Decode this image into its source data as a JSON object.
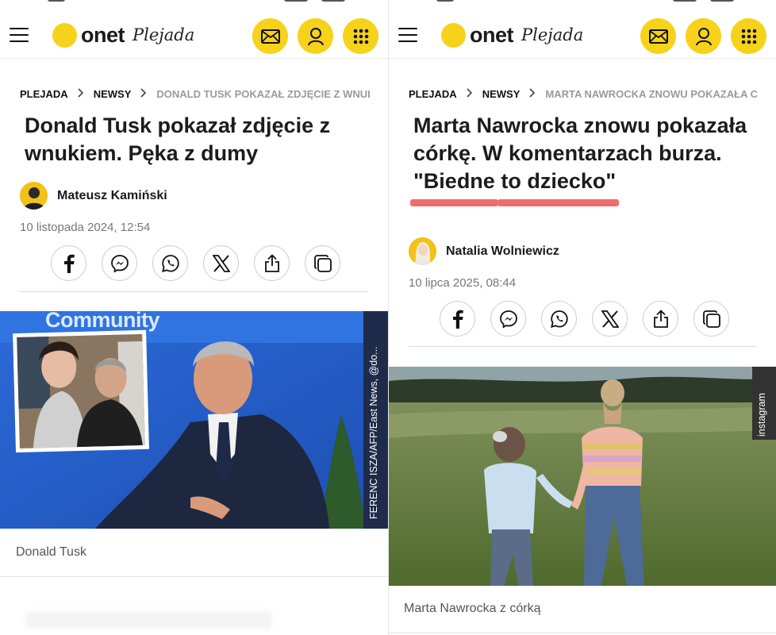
{
  "header": {
    "logo_main": "onet",
    "logo_sub": "Plejada",
    "icons": [
      "menu-icon",
      "mail-icon",
      "user-icon",
      "apps-grid-icon"
    ]
  },
  "left": {
    "breadcrumb": [
      "PLEJADA",
      "NEWSY",
      "DONALD TUSK POKAZAŁ ZDJĘCIE Z WNUI"
    ],
    "title": "Donald Tusk pokazał zdjęcie z wnukiem. Pęka z dumy",
    "author": "Mateusz Kamiński",
    "date": "10 listopada 2024, 12:54",
    "photo_sign": "Community",
    "photo_credit": "FERENC ISZA/AFP/East News, @do...",
    "caption": "Donald Tusk"
  },
  "right": {
    "breadcrumb": [
      "PLEJADA",
      "NEWSY",
      "MARTA NAWROCKA ZNOWU POKAZAŁA C"
    ],
    "title_plain": "Marta Nawrocka znowu pokazała córkę. W komentarzach burza.",
    "title_highlight_1": "\"Biedne",
    "title_highlight_2": "to dziecko\"",
    "author": "Natalia Wolniewicz",
    "date": "10 lipca 2025, 08:44",
    "photo_credit": "instagram",
    "caption": "Marta Nawrocka z córką"
  },
  "share_icons": [
    "facebook-icon",
    "messenger-icon",
    "whatsapp-icon",
    "x-icon",
    "share-icon",
    "copy-icon"
  ],
  "colors": {
    "accent": "#f7d21a",
    "highlight": "#f26b6b"
  }
}
